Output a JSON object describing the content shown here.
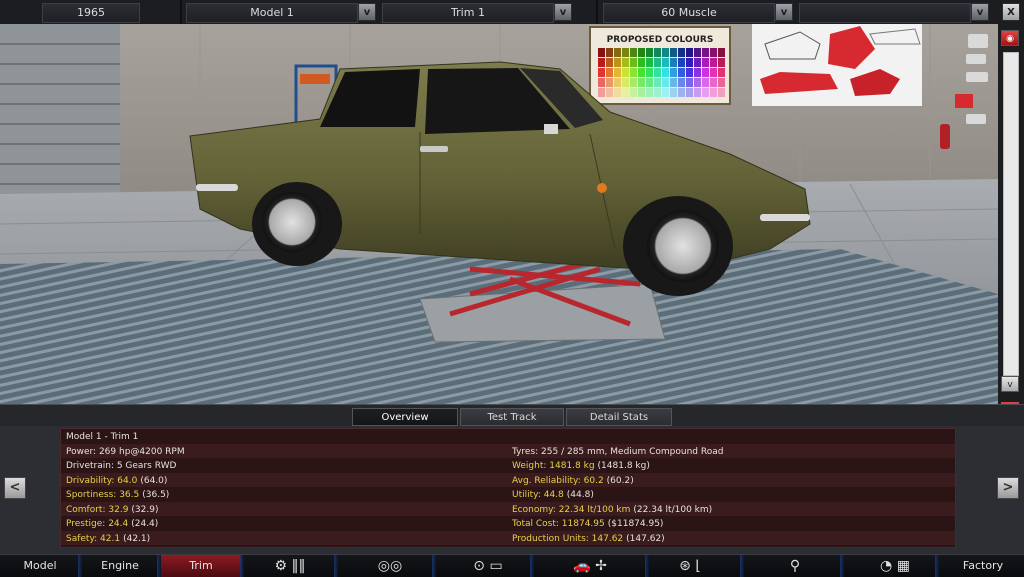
{
  "topbar": {
    "year": "1965",
    "model": "Model 1",
    "trim": "Trim 1",
    "body": "60 Muscle",
    "empty": "",
    "dropdown_glyph": "v",
    "close_glyph": "X"
  },
  "poster": {
    "title": "PROPOSED COLOURS"
  },
  "tabs": [
    {
      "label": "Overview",
      "active": true
    },
    {
      "label": "Test Track",
      "active": false
    },
    {
      "label": "Detail Stats",
      "active": false
    }
  ],
  "stats": {
    "title": "Model 1 - Trim 1",
    "left": [
      {
        "text": "Power: 269 hp@4200 RPM"
      },
      {
        "text": "Drivetrain: 5 Gears RWD"
      },
      {
        "label": "Drivability:",
        "value": "64.0",
        "paren": "(64.0)"
      },
      {
        "label": "Sportiness:",
        "value": "36.5",
        "paren": "(36.5)"
      },
      {
        "label": "Comfort:",
        "value": "32.9",
        "paren": "(32.9)"
      },
      {
        "label": "Prestige:",
        "value": "24.4",
        "paren": "(24.4)"
      },
      {
        "label": "Safety:",
        "value": "42.1",
        "paren": "(42.1)"
      }
    ],
    "right": [
      {
        "text": "Tyres: 255 / 285 mm, Medium Compound Road"
      },
      {
        "label": "Weight:",
        "value": "1481.8 kg",
        "paren": "(1481.8 kg)"
      },
      {
        "label": "Avg. Reliability:",
        "value": "60.2",
        "paren": "(60.2)"
      },
      {
        "label": "Utility:",
        "value": "44.8",
        "paren": "(44.8)"
      },
      {
        "label": "Economy:",
        "value": "22.34 lt/100 km",
        "paren": "(22.34 lt/100 km)"
      },
      {
        "label": "Total Cost:",
        "value": "11874.95",
        "paren": "($11874.95)"
      },
      {
        "label": "Production Units:",
        "value": "147.62",
        "paren": "(147.62)"
      }
    ]
  },
  "nav": {
    "model": "Model",
    "engine": "Engine",
    "trim": "Trim",
    "factory": "Factory",
    "prev": "<",
    "next": ">"
  },
  "colors": {
    "car": "#6b6a3a",
    "accent_red": "#8e1a22",
    "stat_yellow": "#e8d04a"
  }
}
